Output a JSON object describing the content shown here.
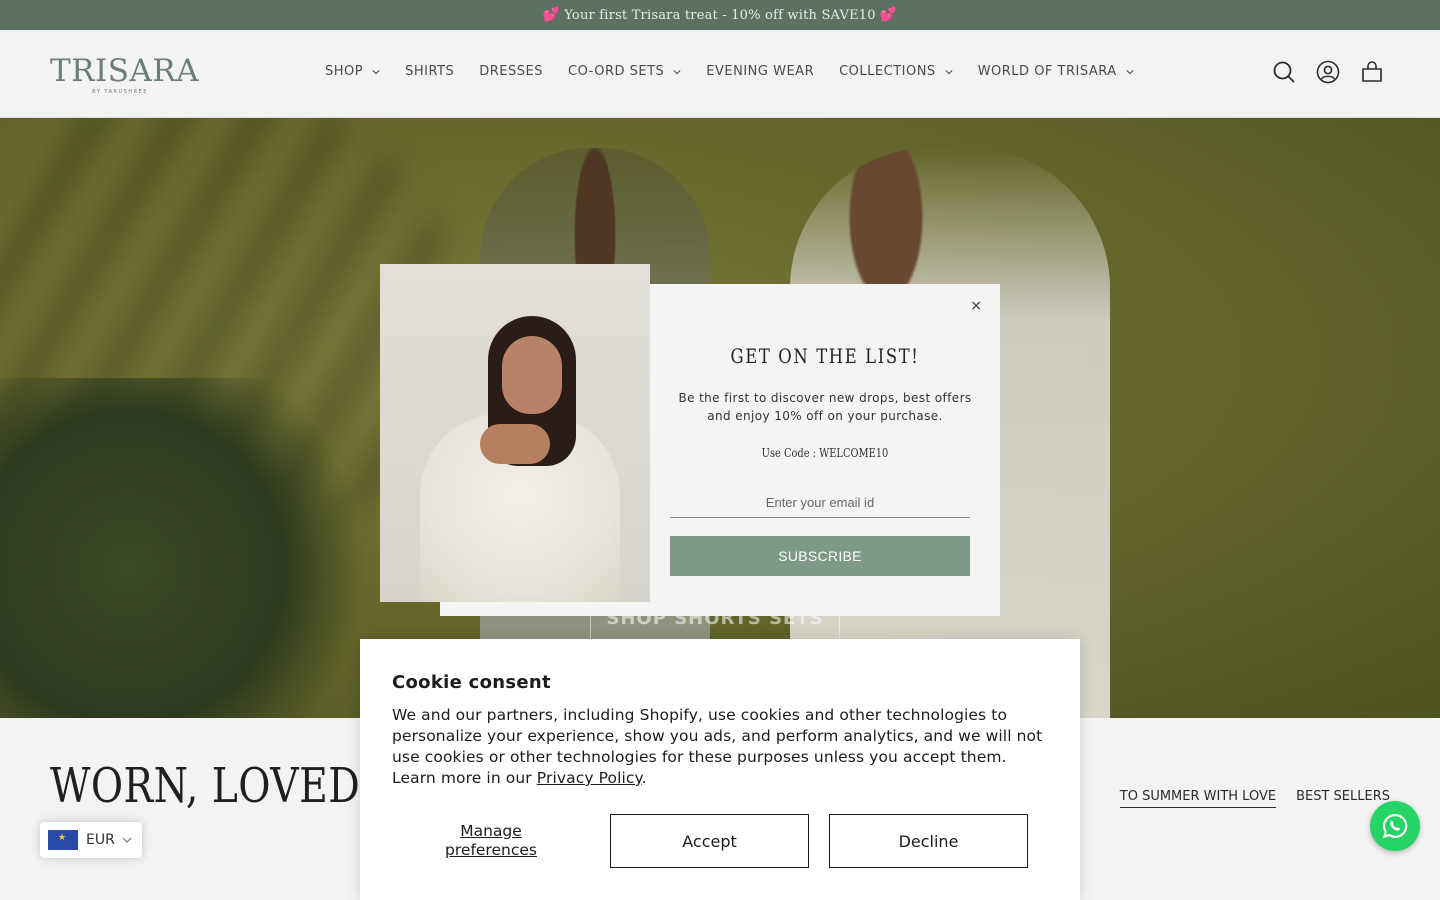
{
  "announcement": {
    "text": "Your first Trisara treat - 10% off with SAVE10",
    "icon": "heart-icon"
  },
  "header": {
    "logo": {
      "word": "TRISARA",
      "sub": "BY TARUSHREE"
    },
    "nav": [
      {
        "label": "SHOP",
        "has_dropdown": true
      },
      {
        "label": "SHIRTS",
        "has_dropdown": false
      },
      {
        "label": "DRESSES",
        "has_dropdown": false
      },
      {
        "label": "CO-ORD SETS",
        "has_dropdown": true
      },
      {
        "label": "EVENING WEAR",
        "has_dropdown": false
      },
      {
        "label": "COLLECTIONS",
        "has_dropdown": true
      },
      {
        "label": "WORLD OF TRISARA",
        "has_dropdown": true
      }
    ],
    "icons": [
      "search-icon",
      "account-icon",
      "cart-icon"
    ]
  },
  "hero": {
    "cta_label": "SHOP SHORTS SETS"
  },
  "section": {
    "title": "WORN, LOVED AN",
    "tabs": [
      {
        "label": "TO SUMMER WITH LOVE",
        "active": true
      },
      {
        "label": "BEST SELLERS",
        "active": false
      }
    ]
  },
  "popup": {
    "close_label": "×",
    "title": "GET ON THE LIST!",
    "description": "Be the first to discover new drops, best offers and enjoy 10% off on your purchase.",
    "code_text": "Use Code : WELCOME10",
    "email_placeholder": "Enter your email id",
    "button_label": "SUBSCRIBE"
  },
  "cookie": {
    "title": "Cookie consent",
    "body": "We and our partners, including Shopify, use cookies and other technologies to personalize your experience, show you ads, and perform analytics, and we will not use cookies or other technologies for these purposes unless you accept them. Learn more in our ",
    "policy_link": "Privacy Policy",
    "period": ".",
    "manage_label": "Manage preferences",
    "accept_label": "Accept",
    "decline_label": "Decline"
  },
  "currency": {
    "code": "EUR"
  },
  "colors": {
    "accent": "#5b7262",
    "button": "#7d9a86",
    "whatsapp": "#25d366"
  }
}
